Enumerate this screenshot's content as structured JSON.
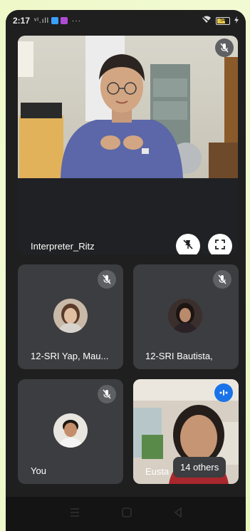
{
  "status_bar": {
    "time": "2:17",
    "signal": "ᵛᴵ.ıll",
    "more": "···",
    "battery": "54"
  },
  "main_tile": {
    "participant_name": "Interpreter_Ritz"
  },
  "tiles": [
    {
      "name": "12-SRI Yap, Mau..."
    },
    {
      "name": "12-SRI Bautista,"
    },
    {
      "name": "You"
    },
    {
      "name": "Eusta"
    }
  ],
  "others": {
    "label": "14 others"
  },
  "colors": {
    "tile_bg": "#3c3d40",
    "page_bg": "#1f1f1f",
    "accent_blue": "#1a73e8",
    "mute_badge": "#5f6063"
  }
}
